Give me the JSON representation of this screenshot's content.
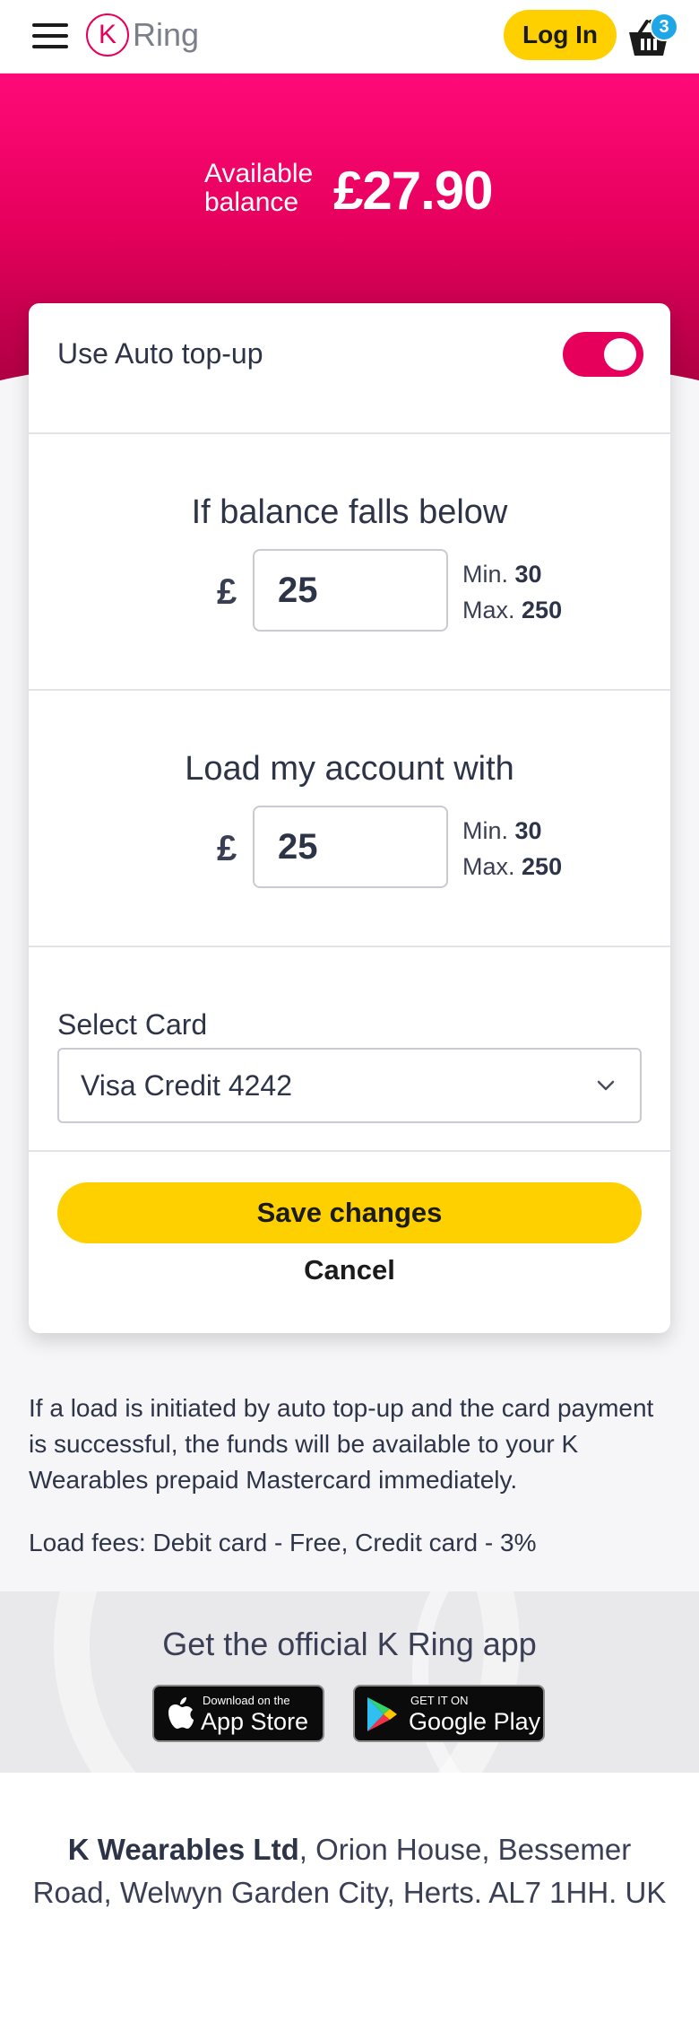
{
  "header": {
    "logo_letter": "K",
    "logo_text": "Ring",
    "login_label": "Log In",
    "cart_count": "3"
  },
  "hero": {
    "balance_label_line1": "Available",
    "balance_label_line2": "balance",
    "balance_value": "£27.90"
  },
  "auto_topup": {
    "label": "Use Auto top-up",
    "enabled": true
  },
  "threshold": {
    "title": "If balance falls below",
    "currency": "£",
    "value": "25",
    "min_label": "Min.",
    "min_value": "30",
    "max_label": "Max.",
    "max_value": "250"
  },
  "load": {
    "title": "Load my account with",
    "currency": "£",
    "value": "25",
    "min_label": "Min.",
    "min_value": "30",
    "max_label": "Max.",
    "max_value": "250"
  },
  "card_select": {
    "label": "Select Card",
    "selected": "Visa Credit 4242"
  },
  "actions": {
    "save_label": "Save changes",
    "cancel_label": "Cancel"
  },
  "info": {
    "paragraph": "If a load is initiated by auto top-up and the card payment is successful, the funds will be available to your K Wearables prepaid Mastercard immediately.",
    "fees": "Load fees: Debit card - Free, Credit card - 3%"
  },
  "app_band": {
    "title": "Get the official K Ring app",
    "appstore_small": "Download on the",
    "appstore_big": "App Store",
    "googleplay_small": "GET IT ON",
    "googleplay_big": "Google Play"
  },
  "footer": {
    "company": "K Wearables Ltd",
    "address_line1": ", Orion House, Bessemer",
    "address_line2": "Road, Welwyn Garden City, Herts. AL7 1HH. UK"
  },
  "colors": {
    "brand_pink": "#e6005c",
    "accent_yellow": "#ffd000",
    "badge_blue": "#1ea6e6"
  },
  "icons": [
    "menu-icon",
    "cart-icon",
    "chevron-down-icon",
    "apple-icon",
    "google-play-icon"
  ]
}
